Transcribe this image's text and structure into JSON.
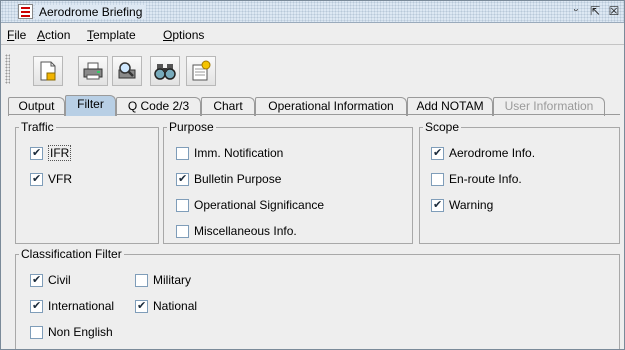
{
  "window": {
    "title": "Aerodrome Briefing",
    "buttons": {
      "minimize": "ᵕ",
      "maximize": "⇱",
      "close": "☒"
    }
  },
  "menu": [
    "File",
    "Action",
    "Template",
    "Options"
  ],
  "toolbar": {
    "buttons": [
      {
        "name": "new-document",
        "icon": "document-icon"
      },
      {
        "name": "print",
        "icon": "printer-icon"
      },
      {
        "name": "print-preview",
        "icon": "magnifier-icon"
      },
      {
        "name": "find",
        "icon": "binoculars-icon"
      },
      {
        "name": "template",
        "icon": "template-icon"
      }
    ]
  },
  "tabs": [
    {
      "label": "Output",
      "state": "normal"
    },
    {
      "label": "Filter",
      "state": "active"
    },
    {
      "label": "Q Code 2/3",
      "state": "normal"
    },
    {
      "label": "Chart",
      "state": "normal"
    },
    {
      "label": "Operational Information",
      "state": "normal"
    },
    {
      "label": "Add NOTAM",
      "state": "normal"
    },
    {
      "label": "User Information",
      "state": "disabled"
    }
  ],
  "traffic": {
    "title": "Traffic",
    "options": [
      {
        "label": "IFR",
        "checked": true
      },
      {
        "label": "VFR",
        "checked": true
      }
    ]
  },
  "purpose": {
    "title": "Purpose",
    "options": [
      {
        "label": "Imm. Notification",
        "checked": false
      },
      {
        "label": "Bulletin Purpose",
        "checked": true
      },
      {
        "label": "Operational Significance",
        "checked": false
      },
      {
        "label": "Miscellaneous Info.",
        "checked": false
      }
    ]
  },
  "scope": {
    "title": "Scope",
    "options": [
      {
        "label": "Aerodrome Info.",
        "checked": true
      },
      {
        "label": "En-route Info.",
        "checked": false
      },
      {
        "label": "Warning",
        "checked": true
      }
    ]
  },
  "classification": {
    "title": "Classification Filter",
    "options": [
      {
        "label": "Civil",
        "checked": true
      },
      {
        "label": "Military",
        "checked": false
      },
      {
        "label": "International",
        "checked": true
      },
      {
        "label": "National",
        "checked": true
      },
      {
        "label": "Non English",
        "checked": false
      }
    ]
  },
  "colors": {
    "active_tab": "#b8cfe5",
    "titlebar": "#dde8f3",
    "checkbox_border": "#7f9db9"
  }
}
